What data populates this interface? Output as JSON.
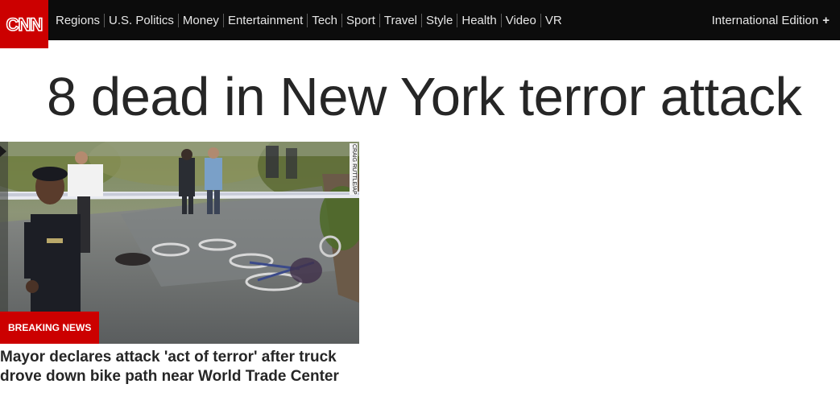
{
  "logo": {
    "text": "CNN"
  },
  "nav": {
    "items": [
      "Regions",
      "U.S. Politics",
      "Money",
      "Entertainment",
      "Tech",
      "Sport",
      "Travel",
      "Style",
      "Health",
      "Video",
      "VR"
    ],
    "edition": {
      "label": "International Edition",
      "icon": "+"
    }
  },
  "headline": "8 dead in New York terror attack",
  "story": {
    "photo_credit": "CRAIG RUTTLE/AP",
    "badge": "BREAKING NEWS",
    "title": "Mayor declares attack 'act of terror' after truck drove down bike path near World Trade Center"
  },
  "colors": {
    "brand_red": "#cc0000",
    "nav_bg": "#0c0c0c",
    "headline_text": "#262626"
  }
}
